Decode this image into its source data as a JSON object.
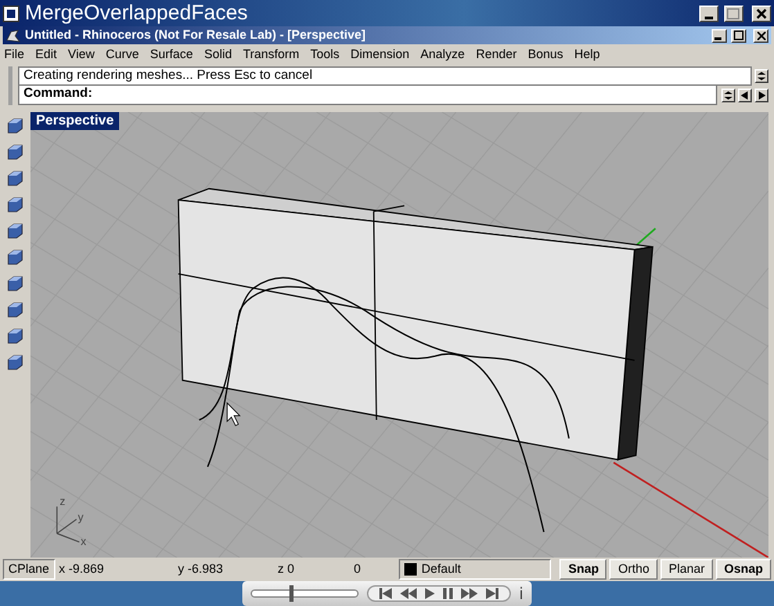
{
  "window": {
    "title": "MergeOverlappedFaces"
  },
  "app_window": {
    "title": "Untitled - Rhinoceros (Not For Resale Lab) - [Perspective]"
  },
  "menu": [
    "File",
    "Edit",
    "View",
    "Curve",
    "Surface",
    "Solid",
    "Transform",
    "Tools",
    "Dimension",
    "Analyze",
    "Render",
    "Bonus",
    "Help"
  ],
  "command_history": "Creating rendering meshes... Press Esc to cancel",
  "command_prompt": "Command:",
  "viewport": {
    "title": "Perspective",
    "axis_labels": [
      "z",
      "y",
      "x"
    ]
  },
  "status_bar": {
    "cplane": "CPlane",
    "x": "x -9.869",
    "y": "y -6.983",
    "z": "z 0",
    "value_4": "0",
    "layer": "Default",
    "toggles": [
      {
        "label": "Snap",
        "on": true
      },
      {
        "label": "Ortho",
        "on": false
      },
      {
        "label": "Planar",
        "on": false
      },
      {
        "label": "Osnap",
        "on": true
      }
    ]
  },
  "player": {
    "level": 0.35,
    "info": "i"
  }
}
